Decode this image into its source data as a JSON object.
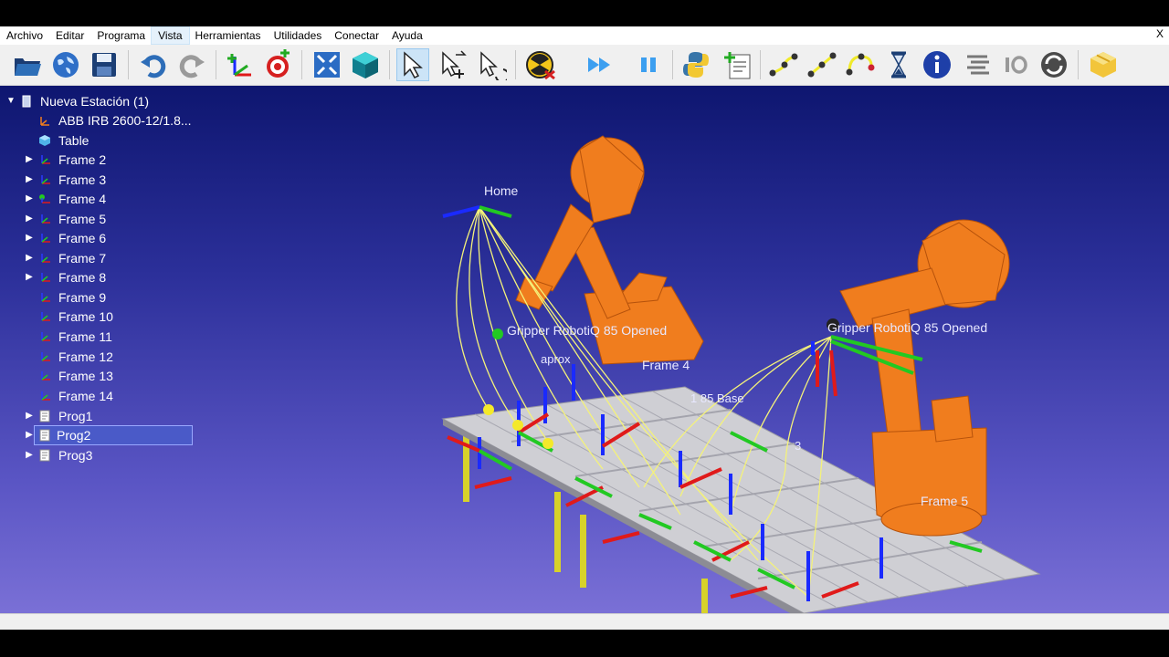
{
  "menu": {
    "items": [
      "Archivo",
      "Editar",
      "Programa",
      "Vista",
      "Herramientas",
      "Utilidades",
      "Conectar",
      "Ayuda"
    ],
    "active_item": "Vista",
    "close_label": "X"
  },
  "toolbar": {
    "buttons": [
      {
        "name": "open-station",
        "icon": "folder-icon"
      },
      {
        "name": "online-library",
        "icon": "globe-icon"
      },
      {
        "name": "save-station",
        "icon": "floppy-icon"
      },
      {
        "name": "undo",
        "icon": "undo-icon"
      },
      {
        "name": "redo",
        "icon": "redo-icon"
      },
      {
        "name": "add-reference-frame",
        "icon": "frame-add-icon"
      },
      {
        "name": "add-target",
        "icon": "target-add-icon"
      },
      {
        "name": "fit-all",
        "icon": "fit-all-icon"
      },
      {
        "name": "isometric-view",
        "icon": "cube-icon"
      },
      {
        "name": "select-tool",
        "icon": "cursor-icon",
        "selected": true
      },
      {
        "name": "select-move-tool",
        "icon": "cursor-move-icon"
      },
      {
        "name": "select-rotate-tool",
        "icon": "cursor-rotate-icon"
      },
      {
        "name": "check-collisions",
        "icon": "radiation-icon"
      },
      {
        "name": "run-program",
        "icon": "fast-forward-icon"
      },
      {
        "name": "pause",
        "icon": "pause-icon"
      },
      {
        "name": "python-script",
        "icon": "python-icon"
      },
      {
        "name": "add-program",
        "icon": "program-add-icon"
      },
      {
        "name": "move-joint",
        "icon": "move-joint-icon"
      },
      {
        "name": "move-linear",
        "icon": "move-linear-icon"
      },
      {
        "name": "move-circular",
        "icon": "move-circular-icon"
      },
      {
        "name": "pause-instruction",
        "icon": "hourglass-icon"
      },
      {
        "name": "show-message",
        "icon": "info-icon"
      },
      {
        "name": "program-call",
        "icon": "program-call-icon"
      },
      {
        "name": "set-io",
        "icon": "io-icon"
      },
      {
        "name": "synchronize",
        "icon": "sync-icon"
      },
      {
        "name": "generate-robot-program",
        "icon": "package-icon"
      }
    ]
  },
  "tree": {
    "root": "Nueva Estación (1)",
    "items": [
      {
        "label": "ABB IRB 2600-12/1.8...",
        "icon": "robot-frame-icon",
        "expandable": false
      },
      {
        "label": "Table",
        "icon": "object-icon",
        "expandable": false
      },
      {
        "label": "Frame 2",
        "icon": "frame-icon",
        "expandable": true
      },
      {
        "label": "Frame 3",
        "icon": "frame-icon",
        "expandable": true
      },
      {
        "label": "Frame 4",
        "icon": "frame-green-icon",
        "expandable": true
      },
      {
        "label": "Frame 5",
        "icon": "frame-icon",
        "expandable": true
      },
      {
        "label": "Frame 6",
        "icon": "frame-icon",
        "expandable": true
      },
      {
        "label": "Frame 7",
        "icon": "frame-icon",
        "expandable": true
      },
      {
        "label": "Frame 8",
        "icon": "frame-icon",
        "expandable": true
      },
      {
        "label": "Frame 9",
        "icon": "frame-icon",
        "expandable": false
      },
      {
        "label": "Frame 10",
        "icon": "frame-icon",
        "expandable": false
      },
      {
        "label": "Frame 11",
        "icon": "frame-icon",
        "expandable": false
      },
      {
        "label": "Frame 12",
        "icon": "frame-icon",
        "expandable": false
      },
      {
        "label": "Frame 13",
        "icon": "frame-icon",
        "expandable": false
      },
      {
        "label": "Frame 14",
        "icon": "frame-icon",
        "expandable": false
      },
      {
        "label": "Prog1",
        "icon": "program-icon",
        "expandable": true
      },
      {
        "label": "Prog2",
        "icon": "program-icon",
        "expandable": true,
        "selected": true
      },
      {
        "label": "Prog3",
        "icon": "program-icon",
        "expandable": true
      }
    ]
  },
  "scene": {
    "labels": {
      "home": "Home",
      "gripper_left": "Gripper RobotiQ 85 Opened",
      "gripper_right": "Gripper RobotiQ 85 Opened",
      "frame4": "Frame 4",
      "frame5": "Frame 5",
      "base": "1 85 Base",
      "aprox": "aprox",
      "frame3_partial": "3"
    }
  },
  "colors": {
    "robot": "#f07d1e",
    "viewport_top": "#0e1670",
    "viewport_bottom": "#7a70d6",
    "path": "#f4f27a",
    "axis_x": "#e01a1a",
    "axis_y": "#22c922",
    "axis_z": "#1a2aff"
  }
}
